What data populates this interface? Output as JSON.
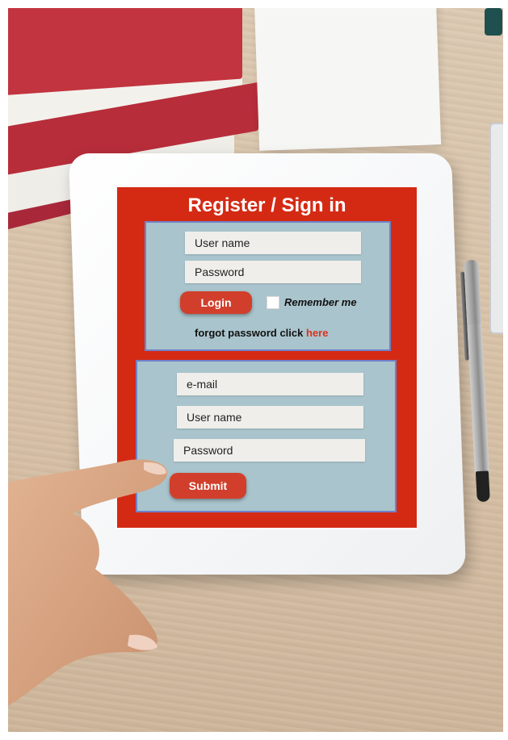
{
  "form": {
    "title": "Register / Sign in",
    "login": {
      "username_label": "User name",
      "password_label": "Password",
      "login_button": "Login",
      "remember_label": "Remember me",
      "remember_checked": false,
      "forgot_text": "forgot password click",
      "forgot_link": "here"
    },
    "register": {
      "email_label": "e-mail",
      "username_label": "User name",
      "password_label": "Password",
      "submit_button": "Submit"
    }
  },
  "colors": {
    "form_red": "#d42a14",
    "panel_bg": "#a9c4cc",
    "panel_border": "#6f81c9",
    "button_red": "#d13f2c",
    "link_red": "#e2301d"
  }
}
